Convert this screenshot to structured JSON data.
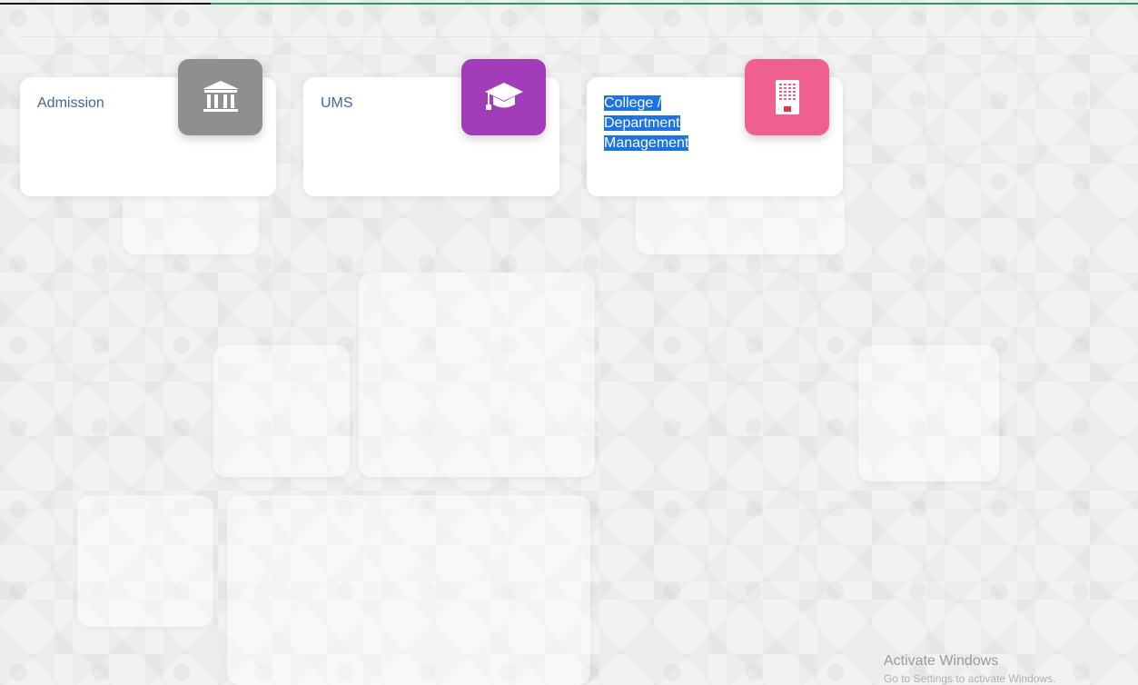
{
  "progress": {
    "fraction": 0.185
  },
  "cards": [
    {
      "label": "Admission",
      "icon": "bank-icon",
      "color": "#8f8f8f"
    },
    {
      "label": "UMS",
      "icon": "graduation-cap-icon",
      "color": "#a33cb8"
    },
    {
      "label_lines": [
        "College /",
        "Department",
        "Management"
      ],
      "icon": "building-icon",
      "color": "#f0608f",
      "selected": true
    }
  ],
  "watermark": {
    "title": "Activate Windows",
    "subtitle": "Go to Settings to activate Windows."
  }
}
